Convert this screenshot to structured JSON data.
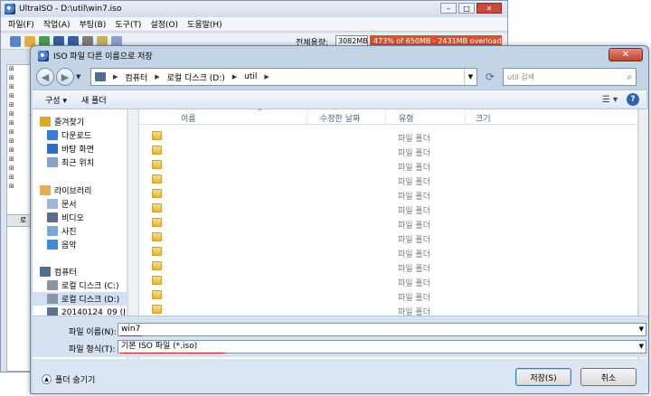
{
  "app": {
    "title": "UltraISO - D:\\util\\win7.iso",
    "menu": [
      "파일(F)",
      "작업(A)",
      "부팅(B)",
      "도구(T)",
      "설정(O)",
      "도움말(H)"
    ],
    "size_label": "전체용량:",
    "size_value": "3082MB",
    "overload_text": "473% of 650MB - 2431MB overload",
    "left_tab_label": "로",
    "window_controls": [
      "–",
      "□",
      "✕"
    ]
  },
  "dialog": {
    "title": "ISO 파일 다른 이름으로 저장",
    "close_glyph": "✕",
    "breadcrumb": [
      "컴퓨터",
      "로컬 디스크 (D:)",
      "util"
    ],
    "search_placeholder": "util 검색",
    "toolbar": {
      "organize": "구성 ▾",
      "new_folder": "새 폴더"
    },
    "nav": [
      {
        "label": "즐겨찾기",
        "icon": "star-icon",
        "color": "#e0a626"
      },
      {
        "label": "다운로드",
        "icon": "download-folder-icon",
        "color": "#3a7bd5"
      },
      {
        "label": "바탕 화면",
        "icon": "desktop-icon",
        "color": "#2f6fc0"
      },
      {
        "label": "최근 위치",
        "icon": "recent-places-icon",
        "color": "#8aa2c2"
      },
      {
        "label": "라이브러리",
        "icon": "library-icon",
        "color": "#e3b04a"
      },
      {
        "label": "문서",
        "icon": "documents-icon",
        "color": "#9fb7d6"
      },
      {
        "label": "비디오",
        "icon": "videos-icon",
        "color": "#5a6e8c"
      },
      {
        "label": "사진",
        "icon": "pictures-icon",
        "color": "#7aa9d8"
      },
      {
        "label": "음악",
        "icon": "music-icon",
        "color": "#3d8bd4"
      },
      {
        "label": "컴퓨터",
        "icon": "computer-icon",
        "color": "#4f6d94"
      },
      {
        "label": "로컬 디스크 (C:)",
        "icon": "drive-c-icon",
        "color": "#8c96a3"
      },
      {
        "label": "로컬 디스크 (D:)",
        "icon": "drive-d-icon",
        "color": "#8c96a3"
      },
      {
        "label": "20140124_09 (J:",
        "icon": "drive-j-icon",
        "color": "#5e7290"
      }
    ],
    "columns": [
      "이름",
      "수정한 날짜",
      "유형",
      "크기"
    ],
    "row_type": "파일 폴더",
    "row_count": 14,
    "filename_label": "파일 이름(N):",
    "filename_value": "win7",
    "filetype_label": "파일 형식(T):",
    "filetype_value": "기본 ISO 파일 (*.iso)",
    "hide_folders": "폴더 숨기기",
    "save_button": "저장(S)",
    "cancel_button": "취소",
    "accent_red": "#e0151b"
  }
}
